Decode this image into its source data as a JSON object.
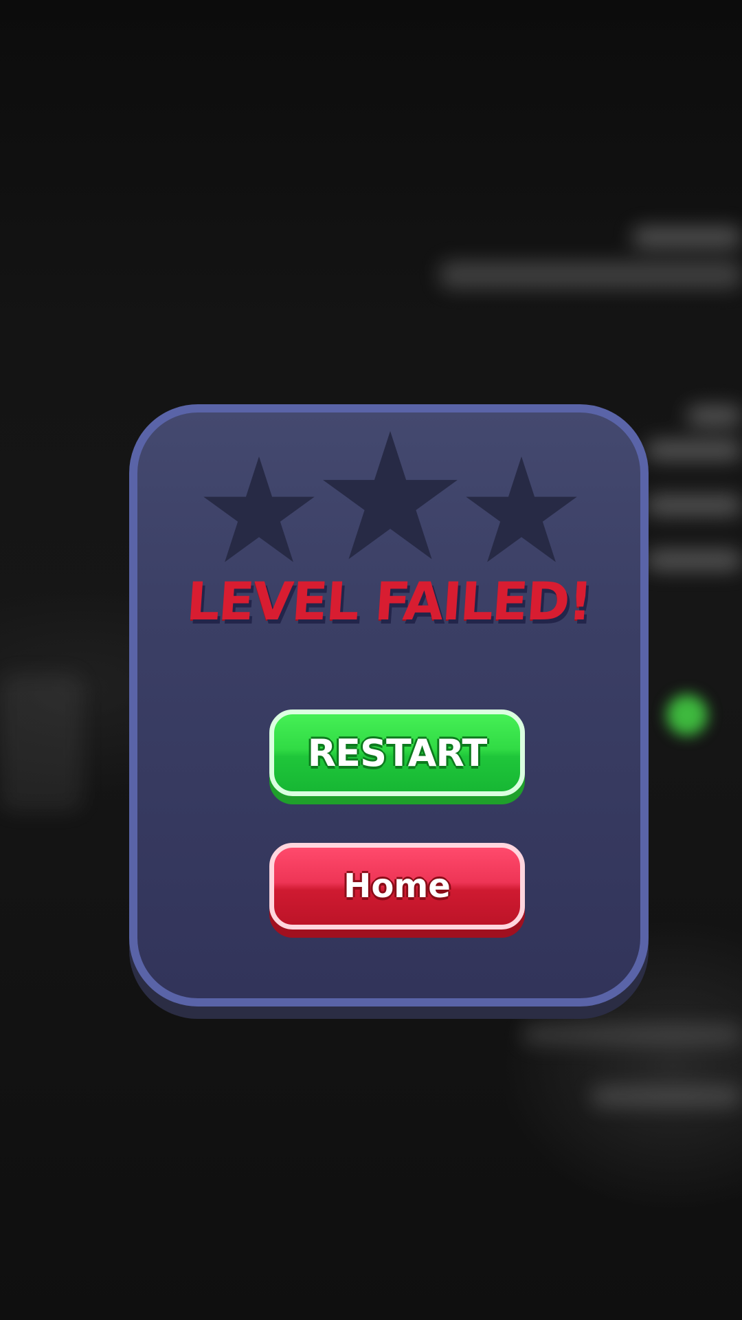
{
  "dialog": {
    "title": "LEVEL FAILED!",
    "stars_earned": 0,
    "stars_total": 3
  },
  "buttons": {
    "restart_label": "RESTART",
    "home_label": "Home"
  },
  "colors": {
    "panel_border": "#5a64a8",
    "panel_fill": "#3b3f65",
    "star_empty": "#272a45",
    "title": "#d81d31",
    "restart_button": "#31db45",
    "home_button": "#ee3556"
  }
}
